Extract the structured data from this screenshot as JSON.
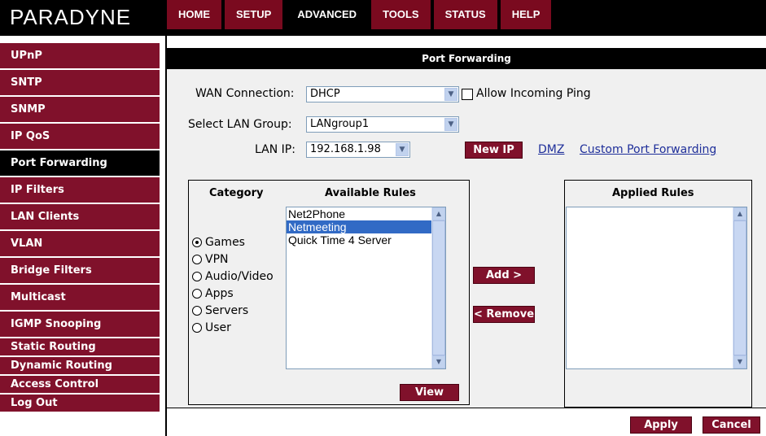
{
  "brand": {
    "logo": "PARADYNE"
  },
  "nav": {
    "tabs": [
      {
        "label": "HOME"
      },
      {
        "label": "SETUP"
      },
      {
        "label": "ADVANCED"
      },
      {
        "label": "TOOLS"
      },
      {
        "label": "STATUS"
      },
      {
        "label": "HELP"
      }
    ],
    "active": "ADVANCED"
  },
  "sidebar": {
    "items": [
      {
        "label": "UPnP"
      },
      {
        "label": "SNTP"
      },
      {
        "label": "SNMP"
      },
      {
        "label": "IP QoS"
      },
      {
        "label": "Port Forwarding"
      },
      {
        "label": "IP Filters"
      },
      {
        "label": "LAN Clients"
      },
      {
        "label": "VLAN"
      },
      {
        "label": "Bridge Filters"
      },
      {
        "label": "Multicast"
      },
      {
        "label": "IGMP Snooping"
      },
      {
        "label": "Static Routing"
      },
      {
        "label": "Dynamic Routing"
      },
      {
        "label": "Access Control"
      },
      {
        "label": "Log Out"
      }
    ],
    "active": "Port Forwarding"
  },
  "page": {
    "title": "Port Forwarding"
  },
  "form": {
    "wan_label": "WAN Connection:",
    "wan_value": "DHCP",
    "ping_label": "Allow Incoming Ping",
    "ping_checked": false,
    "lan_group_label": "Select LAN Group:",
    "lan_group_value": "LANgroup1",
    "lan_ip_label": "LAN IP:",
    "lan_ip_value": "192.168.1.98",
    "new_ip_button": "New IP",
    "dmz_link": "DMZ",
    "custom_link": "Custom Port Forwarding"
  },
  "rules": {
    "category_header": "Category",
    "available_header": "Available Rules",
    "applied_header": "Applied Rules",
    "categories": [
      {
        "label": "Games",
        "selected": true
      },
      {
        "label": "VPN",
        "selected": false
      },
      {
        "label": "Audio/Video",
        "selected": false
      },
      {
        "label": "Apps",
        "selected": false
      },
      {
        "label": "Servers",
        "selected": false
      },
      {
        "label": "User",
        "selected": false
      }
    ],
    "available": [
      "Net2Phone",
      "Netmeeting",
      "Quick Time 4 Server"
    ],
    "available_selected": "Netmeeting",
    "applied": [],
    "view_button": "View",
    "add_button": "Add >",
    "remove_button": "< Remove"
  },
  "footer": {
    "apply_button": "Apply",
    "cancel_button": "Cancel"
  },
  "colors": {
    "accent": "#80112b",
    "header": "#000000",
    "link": "#1f2f9a",
    "selection": "#316ac5"
  }
}
